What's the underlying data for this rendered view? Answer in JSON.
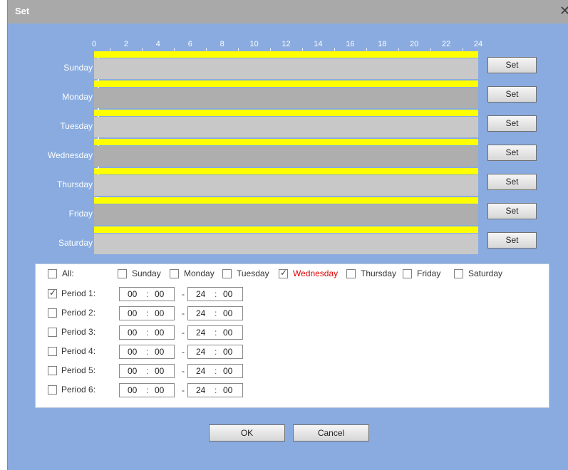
{
  "dialog": {
    "title": "Set",
    "close_glyph": "✕"
  },
  "timeline": {
    "hours": [
      "0",
      "2",
      "4",
      "6",
      "8",
      "10",
      "12",
      "14",
      "16",
      "18",
      "20",
      "22",
      "24"
    ],
    "bar_color": "#ffff00"
  },
  "days": [
    {
      "label": "Sunday",
      "set": "Set",
      "period_color": "#c8c8c8"
    },
    {
      "label": "Monday",
      "set": "Set",
      "period_color": "#aeaeae"
    },
    {
      "label": "Tuesday",
      "set": "Set",
      "period_color": "#c8c8c8"
    },
    {
      "label": "Wednesday",
      "set": "Set",
      "period_color": "#aeaeae"
    },
    {
      "label": "Thursday",
      "set": "Set",
      "period_color": "#c8c8c8"
    },
    {
      "label": "Friday",
      "set": "Set",
      "period_color": "#aeaeae"
    },
    {
      "label": "Saturday",
      "set": "Set",
      "period_color": "#c8c8c8"
    }
  ],
  "selectors": {
    "all": {
      "label": "All:",
      "checked": false
    },
    "days": [
      {
        "label": "Sunday",
        "checked": false
      },
      {
        "label": "Monday",
        "checked": false
      },
      {
        "label": "Tuesday",
        "checked": false
      },
      {
        "label": "Wednesday",
        "checked": true,
        "color": "#e00000"
      },
      {
        "label": "Thursday",
        "checked": false
      },
      {
        "label": "Friday",
        "checked": false
      },
      {
        "label": "Saturday",
        "checked": false
      }
    ]
  },
  "periods": [
    {
      "label": "Period 1:",
      "checked": true,
      "start_h": "00",
      "start_m": "00",
      "end_h": "24",
      "end_m": "00"
    },
    {
      "label": "Period 2:",
      "checked": false,
      "start_h": "00",
      "start_m": "00",
      "end_h": "24",
      "end_m": "00"
    },
    {
      "label": "Period 3:",
      "checked": false,
      "start_h": "00",
      "start_m": "00",
      "end_h": "24",
      "end_m": "00"
    },
    {
      "label": "Period 4:",
      "checked": false,
      "start_h": "00",
      "start_m": "00",
      "end_h": "24",
      "end_m": "00"
    },
    {
      "label": "Period 5:",
      "checked": false,
      "start_h": "00",
      "start_m": "00",
      "end_h": "24",
      "end_m": "00"
    },
    {
      "label": "Period 6:",
      "checked": false,
      "start_h": "00",
      "start_m": "00",
      "end_h": "24",
      "end_m": "00"
    }
  ],
  "separators": {
    "colon": ":",
    "dash": "-",
    "checkmark": "✓"
  },
  "buttons": {
    "ok": "OK",
    "cancel": "Cancel"
  }
}
